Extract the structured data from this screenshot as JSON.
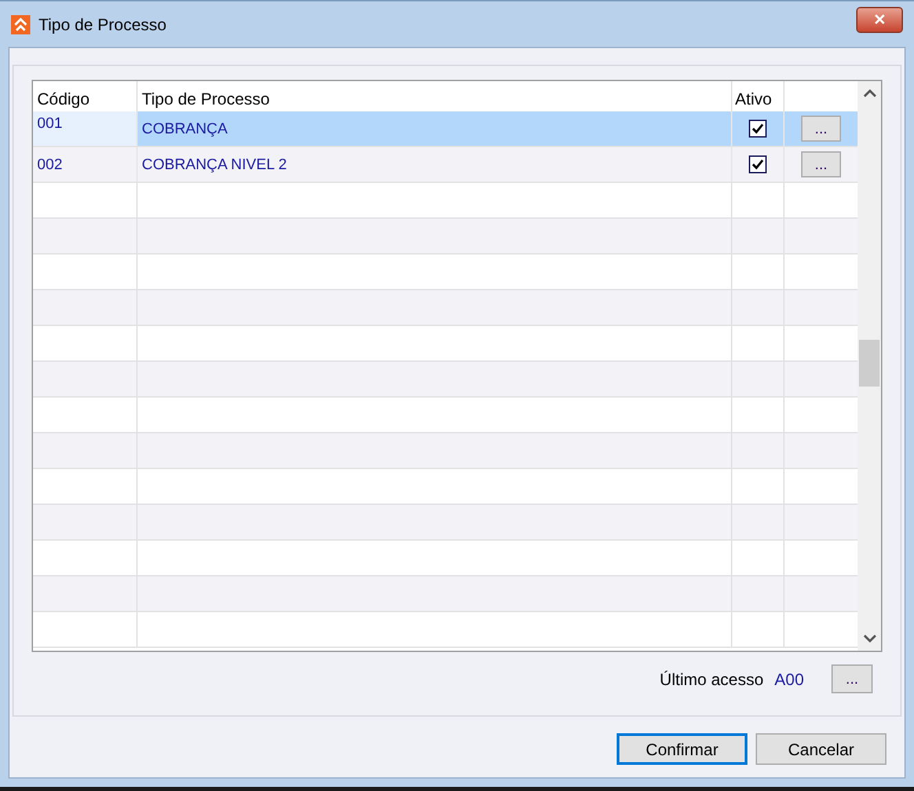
{
  "window": {
    "title": "Tipo de Processo",
    "close": "✕"
  },
  "table": {
    "columns": [
      "Código",
      "Tipo de Processo",
      "Ativo"
    ],
    "rows": [
      {
        "code": "001",
        "name": "COBRANÇA",
        "active": true,
        "button": "...",
        "selected": true
      },
      {
        "code": "002",
        "name": "COBRANÇA NIVEL 2",
        "active": true,
        "button": "...",
        "selected": false
      }
    ]
  },
  "last_access": {
    "label": "Último acesso",
    "value": "A00",
    "button": "..."
  },
  "buttons": [
    {
      "label": "Confirmar",
      "default": true
    },
    {
      "label": "Cancelar",
      "default": false
    }
  ]
}
